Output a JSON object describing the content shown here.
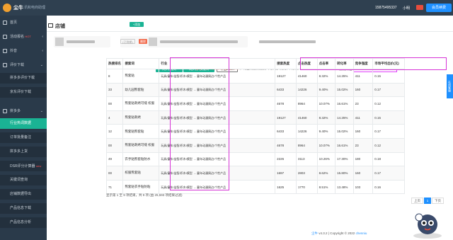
{
  "topbar": {
    "brand": "尘牛",
    "brand_sub": "讯和电商助理",
    "phone": "15875495337",
    "user": "小明",
    "lang_icon": "china-flag-icon",
    "renew_label": "会员续费"
  },
  "sidebar": {
    "items": [
      {
        "label": "首页",
        "icon": "home-icon"
      },
      {
        "label": "活动报名",
        "icon": "calendar-icon",
        "badge": "HOT"
      },
      {
        "label": "抖音",
        "icon": "music-icon"
      },
      {
        "label": "评价下载",
        "icon": "star-icon"
      }
    ],
    "sub_a": [
      {
        "label": "拼多多评价下载"
      },
      {
        "label": "京东评价下载"
      }
    ],
    "group": {
      "label": "拼多多",
      "icon": "shop-icon"
    },
    "sub_b": [
      {
        "label": "行业热词数据",
        "active": true
      },
      {
        "label": "订单批量备注"
      },
      {
        "label": "拼多多上货"
      },
      {
        "label": "DSR评分计算器",
        "badge": "new"
      },
      {
        "label": "关键词查询"
      },
      {
        "label": "店铺数据导出"
      },
      {
        "label": "产品信息下载"
      },
      {
        "label": "产品信息分析"
      }
    ]
  },
  "header": {
    "title": "店铺"
  },
  "shops": {
    "add_label": "+添加",
    "renew_tag": "(已到期)",
    "delete_label": "删除"
  },
  "toolbar": {
    "sync_hot": "同步热搜词",
    "sync_category": "同步热门关键词",
    "export": "导出Excel",
    "notice_red": "注意：请不要频繁点击同步操作",
    "notice_rest": "，行业热搜数据(前7天) 同步完成，共获取25993条数据。",
    "filter_label": "模糊筛选:",
    "filter_value": "熊套贴"
  },
  "table": {
    "headers": [
      "热搜排名",
      "搜索词",
      "行业",
      "搜索热度",
      "点击热度",
      "点击率",
      "转化率",
      "竞争强度",
      "市场平均出价(元)"
    ],
    "rows": [
      [
        "8",
        "熊套贴",
        "玩具/童车/益智/积木/模型 → 童年动漫周边/个性产品",
        "19127",
        "41460",
        "8.32%",
        "14.25%",
        "411",
        "0.15"
      ],
      [
        "33",
        "幼儿园熊套贴",
        "玩具/童车/益智/积木/模型 → 童年动漫周边/个性产品",
        "6433",
        "14226",
        "9.40%",
        "15.02%",
        "160",
        "0.17"
      ],
      [
        "00",
        "熊套贴刺绣可缝 校服",
        "玩具/童车/益智/积木/模型 → 童年动漫周边/个性产品",
        "4678",
        "8964",
        "10.07%",
        "16.61%",
        "23",
        "0.12"
      ],
      [
        "4",
        "熊套贴刺绣",
        "玩具/童车/益智/积木/模型 → 童年动漫周边/个性产品",
        "19127",
        "41460",
        "8.32%",
        "14.25%",
        "411",
        "0.15"
      ],
      [
        "12",
        "熊套贴熊套贴",
        "玩具/童车/益智/积木/模型 → 童年动漫周边/个性产品",
        "6433",
        "14226",
        "9.40%",
        "15.02%",
        "160",
        "0.17"
      ],
      [
        "00",
        "熊套贴刺绣可缝 校服",
        "玩具/童车/益智/积木/模型 → 童年动漫周边/个性产品",
        "4678",
        "8964",
        "10.07%",
        "16.61%",
        "23",
        "0.12"
      ],
      [
        "49",
        "衣手贴熊套贴防水",
        "玩具/童车/益智/积木/模型 → 童年动漫周边/个性产品",
        "2226",
        "3113",
        "10.26%",
        "17.30%",
        "180",
        "0.18"
      ],
      [
        "00",
        "校服熊套贴",
        "玩具/童车/益智/积木/模型 → 童年动漫周边/个性产品",
        "1697",
        "2803",
        "8.62%",
        "15.80%",
        "160",
        "0.17"
      ],
      [
        "71",
        "熊套贴衣手贴防粘",
        "玩具/童车/益智/积木/模型 → 童年动漫周边/个性产品",
        "1625",
        "1770",
        "8.51%",
        "13.48%",
        "103",
        "0.16"
      ]
    ],
    "summary": "显示第 1 至 9 项结果，共 9 项 (由 25,593 项结果过滤)"
  },
  "pagination": {
    "prev": "上页",
    "current": "1",
    "next": "下页"
  },
  "footer": {
    "brand": "尘牛",
    "version": "v4.3.2",
    "copyright": "| Copyright © 2022",
    "company": "chenniu"
  },
  "side_tab": "在线客服",
  "colors": {
    "accent_green": "#1ab394",
    "sidebar": "#2a3a4a",
    "topbar": "#2f4050",
    "highlight": "#d633d6",
    "primary": "#1e90ff"
  }
}
